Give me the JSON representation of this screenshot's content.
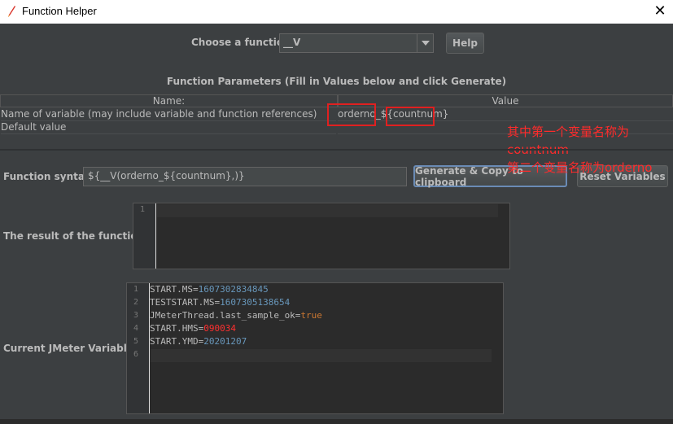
{
  "window": {
    "title": "Function Helper",
    "close_icon": "✕"
  },
  "chooser": {
    "label": "Choose a function",
    "selected": "__V",
    "help_label": "Help"
  },
  "params": {
    "title": "Function Parameters (Fill in Values below and click Generate)",
    "headers": {
      "name": "Name:",
      "value": "Value"
    },
    "rows": [
      {
        "name": "Name of variable (may include variable and function references)",
        "value": "orderno_${countnum}"
      },
      {
        "name": "Default value",
        "value": ""
      }
    ]
  },
  "annotation": {
    "line1": "其中第一个变量名称为",
    "line2": "countnum",
    "line3": "第二个变量名称为orderno",
    "color": "#ff2b2b"
  },
  "syntax": {
    "label": "Function syntax:",
    "value": "${__V(orderno_${countnum},)}",
    "generate_label": "Generate & Copy to clipboard",
    "reset_label": "Reset Variables"
  },
  "result": {
    "label": "The result of the function is",
    "lines": [
      "1"
    ]
  },
  "variables": {
    "label": "Current JMeter Variables",
    "lines": [
      {
        "n": "1",
        "key": "START.MS=",
        "val": "1607302834845",
        "kind": "num"
      },
      {
        "n": "2",
        "key": "TESTSTART.MS=",
        "val": "1607305138654",
        "kind": "num"
      },
      {
        "n": "3",
        "key": "JMeterThread.last_sample_ok=",
        "val": "true",
        "kind": "kw"
      },
      {
        "n": "4",
        "key": "START.HMS=",
        "val": "090034",
        "kind": "red"
      },
      {
        "n": "5",
        "key": "START.YMD=",
        "val": "20201207",
        "kind": "num"
      },
      {
        "n": "6",
        "key": "",
        "val": "",
        "kind": ""
      }
    ]
  }
}
